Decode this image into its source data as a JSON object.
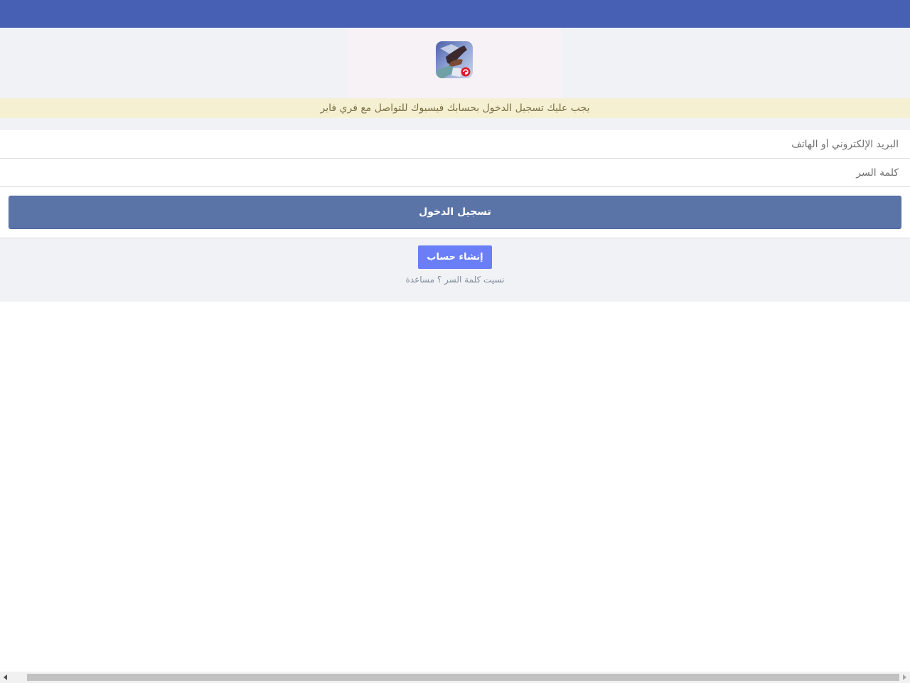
{
  "notice": {
    "text": "يجب عليك تسجيل الدخول بحسابك فيسبوك للتواصل مع فري فاير"
  },
  "form": {
    "email_placeholder": "البريد الإلكتروني أو الهاتف",
    "email_value": "",
    "password_placeholder": "كلمة السر",
    "password_value": "",
    "login_label": "تسجيل الدخول"
  },
  "footer": {
    "create_account_label": "إنشاء حساب",
    "forgot_password_label": "نسيت كلمة السر ؟",
    "help_label": "مساعدة"
  },
  "colors": {
    "topbar": "#4760b3",
    "login_button": "#5b74a8",
    "create_button": "#6a7ff7",
    "notice_bg": "#f5f0d2"
  },
  "icons": {
    "app_icon": "free-fire-app-icon"
  }
}
